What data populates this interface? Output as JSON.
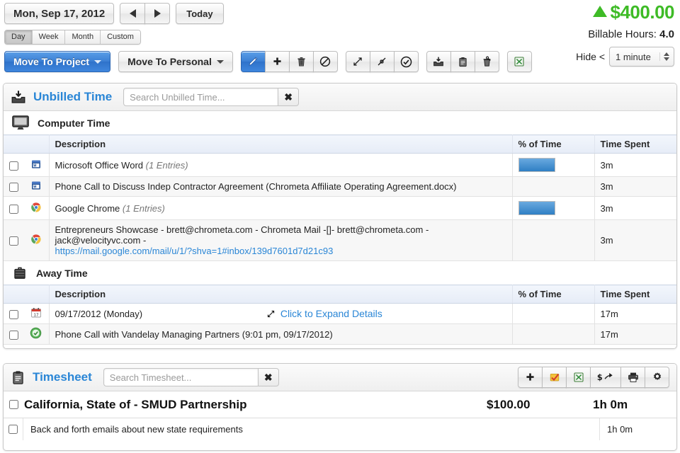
{
  "header": {
    "date_label": "Mon, Sep 17, 2012",
    "prev_label": "Previous",
    "next_label": "Next",
    "today_label": "Today",
    "range_tabs": [
      {
        "label": "Day",
        "active": true
      },
      {
        "label": "Week",
        "active": false
      },
      {
        "label": "Month",
        "active": false
      },
      {
        "label": "Custom",
        "active": false
      }
    ],
    "move_to_project_label": "Move To Project",
    "move_to_personal_label": "Move To Personal",
    "tool_buttons": [
      {
        "name": "edit-button",
        "icon": "pencil-icon",
        "active": true
      },
      {
        "name": "add-button",
        "icon": "plus-icon",
        "active": false
      },
      {
        "name": "delete-button",
        "icon": "trash-icon",
        "active": false
      },
      {
        "name": "ignore-button",
        "icon": "no-entry-icon",
        "active": false
      }
    ],
    "expand_buttons": [
      {
        "name": "expand-all-button",
        "icon": "expand-arrows-icon"
      },
      {
        "name": "collapse-all-button",
        "icon": "collapse-arrows-icon"
      },
      {
        "name": "approve-button",
        "icon": "check-circle-icon"
      }
    ],
    "move_buttons": [
      {
        "name": "move-to-unbilled-button",
        "icon": "inbox-icon"
      },
      {
        "name": "move-to-timesheet-button",
        "icon": "clipboard-icon"
      },
      {
        "name": "discard-button",
        "icon": "trash-pen-icon"
      }
    ],
    "export_button": {
      "name": "export-excel-button",
      "icon": "excel-icon"
    },
    "amount": "$400.00",
    "amount_color": "#3ebb26",
    "trend_direction": "up",
    "billable_hours_label": "Billable Hours:",
    "billable_hours_value": "4.0",
    "hide_label": "Hide <",
    "hide_value": "1 minute"
  },
  "unbilled": {
    "title": "Unbilled Time",
    "icon": "inbox-icon",
    "search_placeholder": "Search Unbilled Time...",
    "search_value": "",
    "clear_label": "✖",
    "sections": [
      {
        "label": "Computer Time",
        "icon": "monitor-icon",
        "columns": [
          "Description",
          "% of Time",
          "Time Spent"
        ],
        "rows": [
          {
            "indent": false,
            "icon": "word-icon",
            "description": "Microsoft Office Word",
            "entries": "(1 Entries)",
            "pct_bar": 100,
            "time_spent": "3m",
            "link": ""
          },
          {
            "indent": true,
            "icon": "word-icon",
            "description": "Phone Call to Discuss Indep Contractor Agreement (Chrometa Affiliate Operating Agreement.docx)",
            "entries": "",
            "pct_bar": 0,
            "time_spent": "3m",
            "link": ""
          },
          {
            "indent": false,
            "icon": "chrome-icon",
            "description": "Google Chrome",
            "entries": "(1 Entries)",
            "pct_bar": 100,
            "time_spent": "3m",
            "link": ""
          },
          {
            "indent": true,
            "icon": "chrome-icon",
            "description": "Entrepreneurs Showcase - brett@chrometa.com - Chrometa Mail -[]- brett@chrometa.com - jack@velocityvc.com -",
            "entries": "",
            "pct_bar": 0,
            "time_spent": "3m",
            "link": "https://mail.google.com/mail/u/1/?shva=1#inbox/139d7601d7d21c93"
          }
        ]
      },
      {
        "label": "Away Time",
        "icon": "suitcase-icon",
        "columns": [
          "Description",
          "% of Time",
          "Time Spent"
        ],
        "rows": [
          {
            "indent": false,
            "icon": "calendar-icon",
            "description": "09/17/2012 (Monday)",
            "entries": "",
            "pct_bar": 0,
            "time_spent": "17m",
            "expand_label": "Click to Expand Details"
          },
          {
            "indent": true,
            "icon": "green-check-icon",
            "description": "Phone Call with Vandelay Managing Partners (9:01 pm, 09/17/2012)",
            "entries": "",
            "pct_bar": 0,
            "time_spent": "17m",
            "expand_label": ""
          }
        ]
      }
    ]
  },
  "timesheet": {
    "title": "Timesheet",
    "icon": "clipboard-icon",
    "search_placeholder": "Search Timesheet...",
    "search_value": "",
    "clear_label": "✖",
    "tools": [
      {
        "name": "add-entry-button",
        "icon": "plus-icon"
      },
      {
        "name": "approve-entry-button",
        "icon": "yellow-check-icon"
      },
      {
        "name": "export-excel-button",
        "icon": "excel-icon"
      },
      {
        "name": "invoice-button",
        "icon": "dollar-arrow-icon"
      },
      {
        "name": "print-button",
        "icon": "printer-icon"
      },
      {
        "name": "settings-button",
        "icon": "gear-icon"
      }
    ],
    "groups": [
      {
        "name": "California, State of - SMUD Partnership",
        "amount": "$100.00",
        "duration": "1h 0m",
        "rows": [
          {
            "description": "Back and forth emails about new state requirements",
            "duration": "1h 0m"
          }
        ]
      }
    ]
  }
}
